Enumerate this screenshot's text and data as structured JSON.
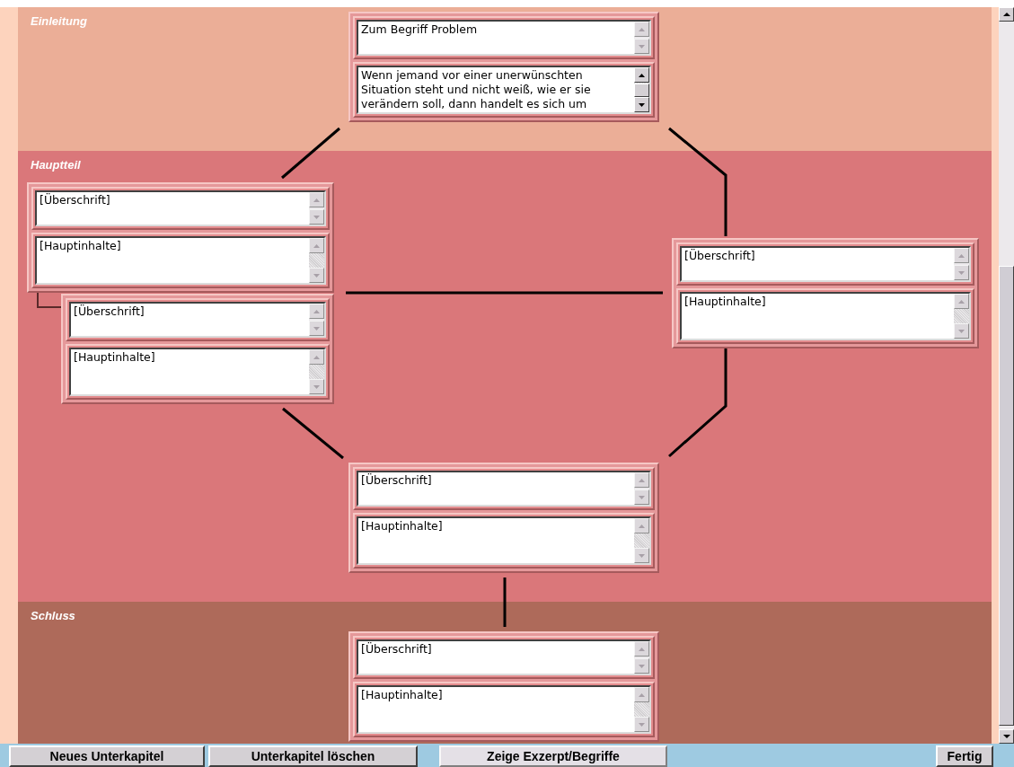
{
  "sections": [
    {
      "title": "Einleitung"
    },
    {
      "title": "Hauptteil"
    },
    {
      "title": "Schluss"
    }
  ],
  "nodes": [
    {
      "heading": "Zum Begriff Problem",
      "content": "Wenn jemand vor einer unerwünschten Situation steht und nicht weiß, wie er sie verändern soll, dann handelt es sich um",
      "scrollable": true
    },
    {
      "heading": "[Überschrift]",
      "content": "[Hauptinhalte]",
      "scrollable": false
    },
    {
      "heading": "[Überschrift]",
      "content": "[Hauptinhalte]",
      "scrollable": false
    },
    {
      "heading": "[Überschrift]",
      "content": "[Hauptinhalte]",
      "scrollable": false
    },
    {
      "heading": "[Überschrift]",
      "content": "[Hauptinhalte]",
      "scrollable": false
    },
    {
      "heading": "[Überschrift]",
      "content": "[Hauptinhalte]",
      "scrollable": false
    }
  ],
  "buttons": [
    {
      "label": "Neues Unterkapitel",
      "selected": false
    },
    {
      "label": "Unterkapitel löschen",
      "selected": false
    },
    {
      "label": "Zeige Exzerpt/Begriffe",
      "selected": true
    },
    {
      "label": "Fertig",
      "selected": false
    }
  ]
}
